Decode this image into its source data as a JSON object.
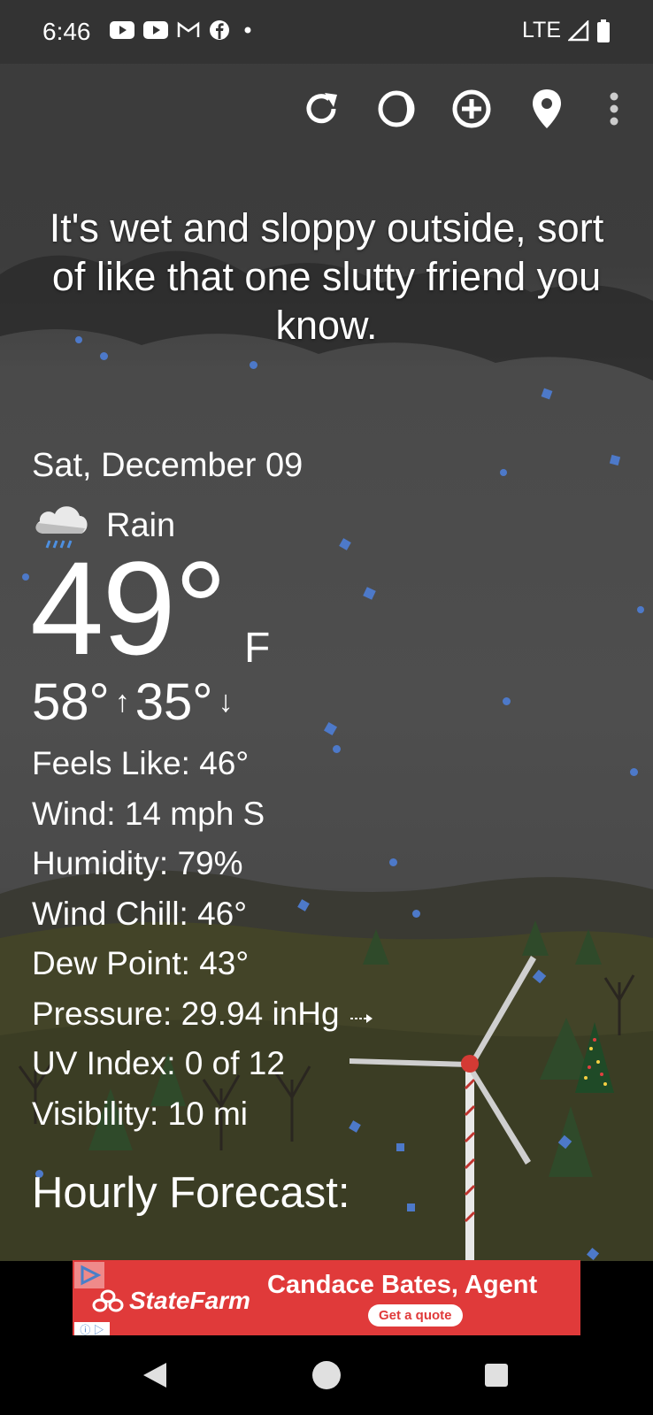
{
  "status_bar": {
    "time": "6:46",
    "notification_icons": [
      "youtube-icon",
      "youtube-icon",
      "gmail-icon",
      "facebook-icon",
      "dot-icon"
    ],
    "network": "LTE"
  },
  "toolbar": {
    "icons": [
      "refresh-icon",
      "moon-phase-icon",
      "add-location-icon",
      "location-pin-icon",
      "more-vert-icon"
    ]
  },
  "tagline": "It's wet and sloppy outside, sort of like that one slutty friend you know.",
  "weather": {
    "date": "Sat, December 09",
    "condition": "Rain",
    "condition_icon": "rain-cloud-icon",
    "temperature": "49°",
    "unit": "F",
    "high": "58°",
    "low": "35°",
    "details": [
      {
        "label": "Feels Like:",
        "value": "46°"
      },
      {
        "label": "Wind:",
        "value": "14 mph S"
      },
      {
        "label": "Humidity:",
        "value": "79%"
      },
      {
        "label": "Wind Chill:",
        "value": "46°"
      },
      {
        "label": "Dew Point:",
        "value": "43°"
      },
      {
        "label": "Pressure:",
        "value": "29.94 inHg"
      },
      {
        "label": "UV Index:",
        "value": "0 of 12"
      },
      {
        "label": "Visibility:",
        "value": "10 mi"
      }
    ],
    "pressure_trend_icon": "steady-arrow-icon",
    "hourly_heading": "Hourly Forecast:"
  },
  "ad": {
    "brand": "StateFarm",
    "agent": "Candace Bates, Agent",
    "cta": "Get a quote",
    "background_color": "#e03a3a"
  },
  "navigation": [
    "back-icon",
    "home-icon",
    "recents-icon"
  ]
}
